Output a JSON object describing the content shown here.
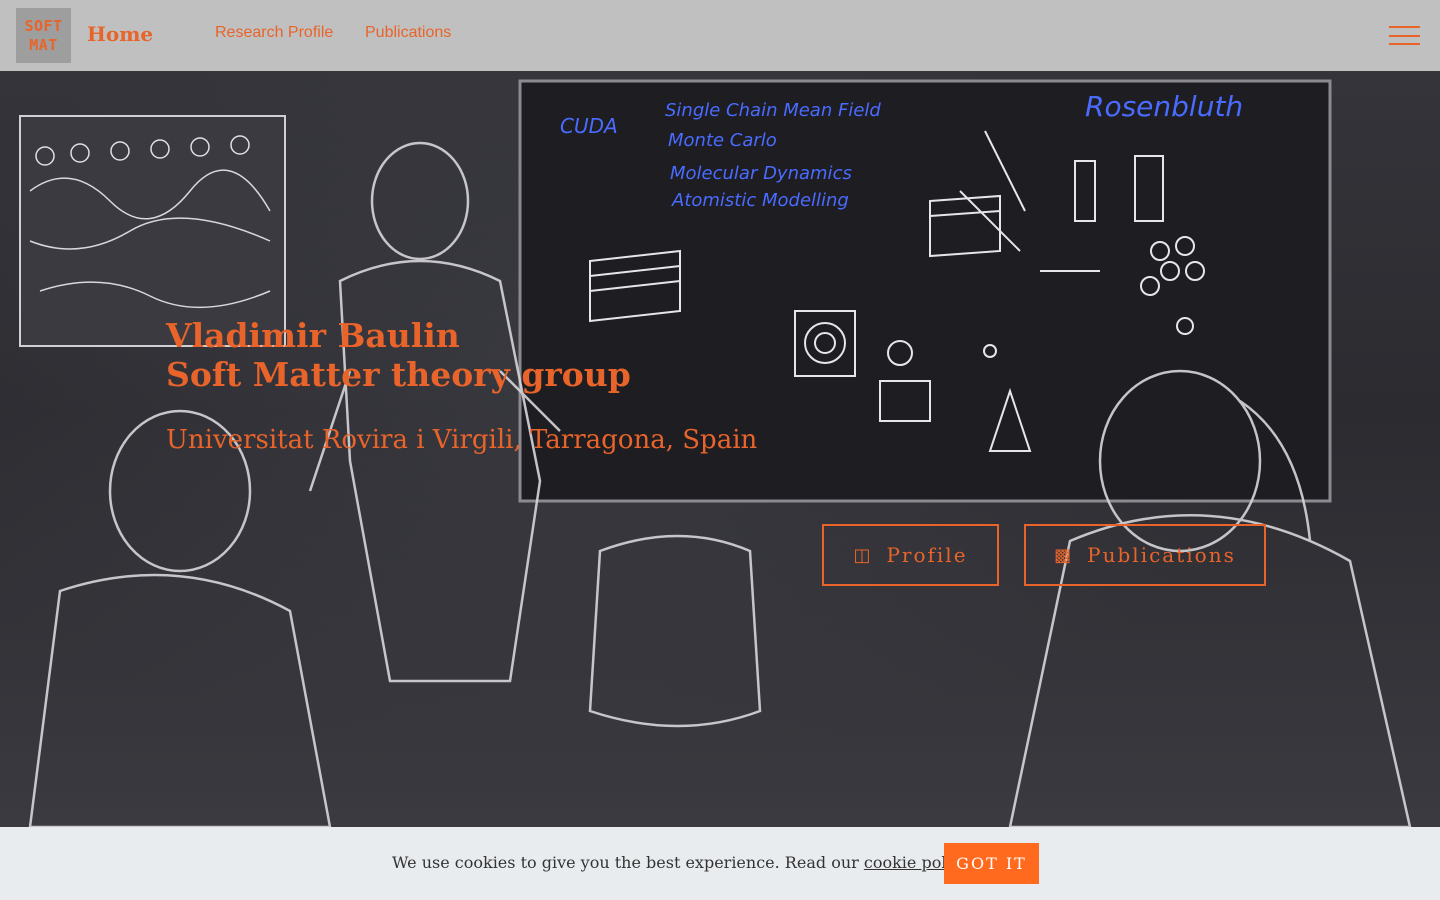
{
  "nav": {
    "logo_line1": "SOFT",
    "logo_line2": "MAT",
    "brand": "Home",
    "links": [
      "Research Profile",
      "Publications"
    ],
    "menu_icon": "hamburger-menu-icon"
  },
  "hero": {
    "name": "Vladimir Baulin",
    "group": "Soft Matter theory group",
    "affiliation": "Universitat Rovira i Virgili, Tarragona, Spain",
    "buttons": [
      {
        "label": "Profile",
        "icon": "book-open-icon"
      },
      {
        "label": "Publications",
        "icon": "book-icon"
      }
    ],
    "board_words": [
      "CUDA",
      "Single Chain Mean Field",
      "Monte Carlo",
      "Molecular Dynamics",
      "Atomistic Modelling",
      "Rosenbluth"
    ]
  },
  "cookie": {
    "text": "We use cookies to give you the best experience. Read our",
    "link": "cookie policy",
    "period": ".",
    "button": "GOT IT"
  },
  "colors": {
    "accent": "#e8642a",
    "navbar": "#c0c0c0",
    "cookie_bg": "#e9ecef",
    "cookie_button": "#ff6a1f",
    "board_text": "#3b5bff"
  }
}
